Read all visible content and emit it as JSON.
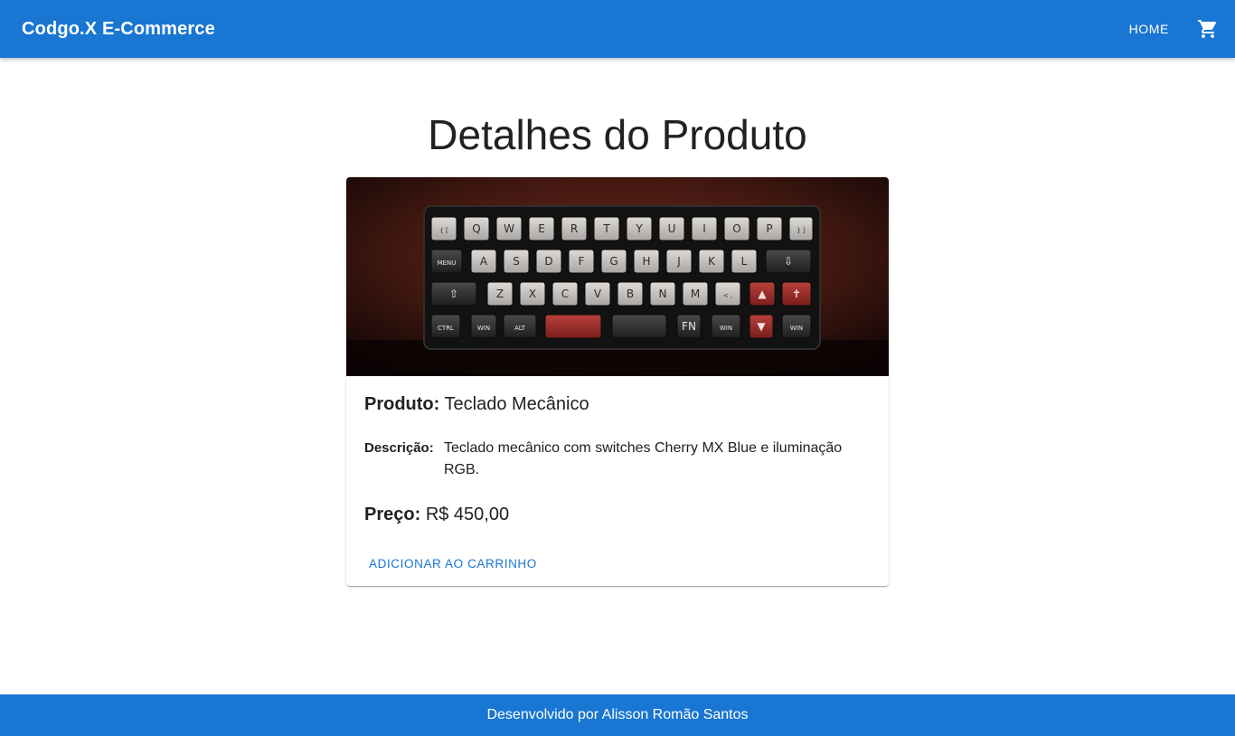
{
  "header": {
    "brand": "Codgo.X E-Commerce",
    "home_label": "HOME",
    "cart_icon": "shopping-cart-icon",
    "background_color": "#1976d2"
  },
  "main": {
    "title": "Detalhes do Produto"
  },
  "product": {
    "image_icon": "keyboard-image",
    "name_label": "Produto:",
    "name": "Teclado Mecânico",
    "description_label": "Descrição:",
    "description": "Teclado mecânico com switches Cherry MX Blue e iluminação RGB.",
    "price_label": "Preço:",
    "price": "R$ 450,00",
    "add_to_cart_label": "ADICIONAR AO CARRINHO"
  },
  "keyboard": {
    "rows": [
      [
        "{ [",
        "Q",
        "W",
        "E",
        "R",
        "T",
        "Y",
        "U",
        "I",
        "O",
        "P",
        "} ]"
      ],
      [
        "MENU",
        "A",
        "S",
        "D",
        "F",
        "G",
        "H",
        "J",
        "K",
        "L",
        "⇩"
      ],
      [
        "⇧",
        "Z",
        "X",
        "C",
        "V",
        "B",
        "N",
        "M",
        "< ,",
        "▲",
        "✝"
      ],
      [
        "CTRL",
        "WIN",
        "ALT",
        "",
        "",
        "FN",
        "WIN",
        "▼",
        "WIN"
      ]
    ]
  },
  "footer": {
    "text": "Desenvolvido por Alisson Romão Santos"
  }
}
